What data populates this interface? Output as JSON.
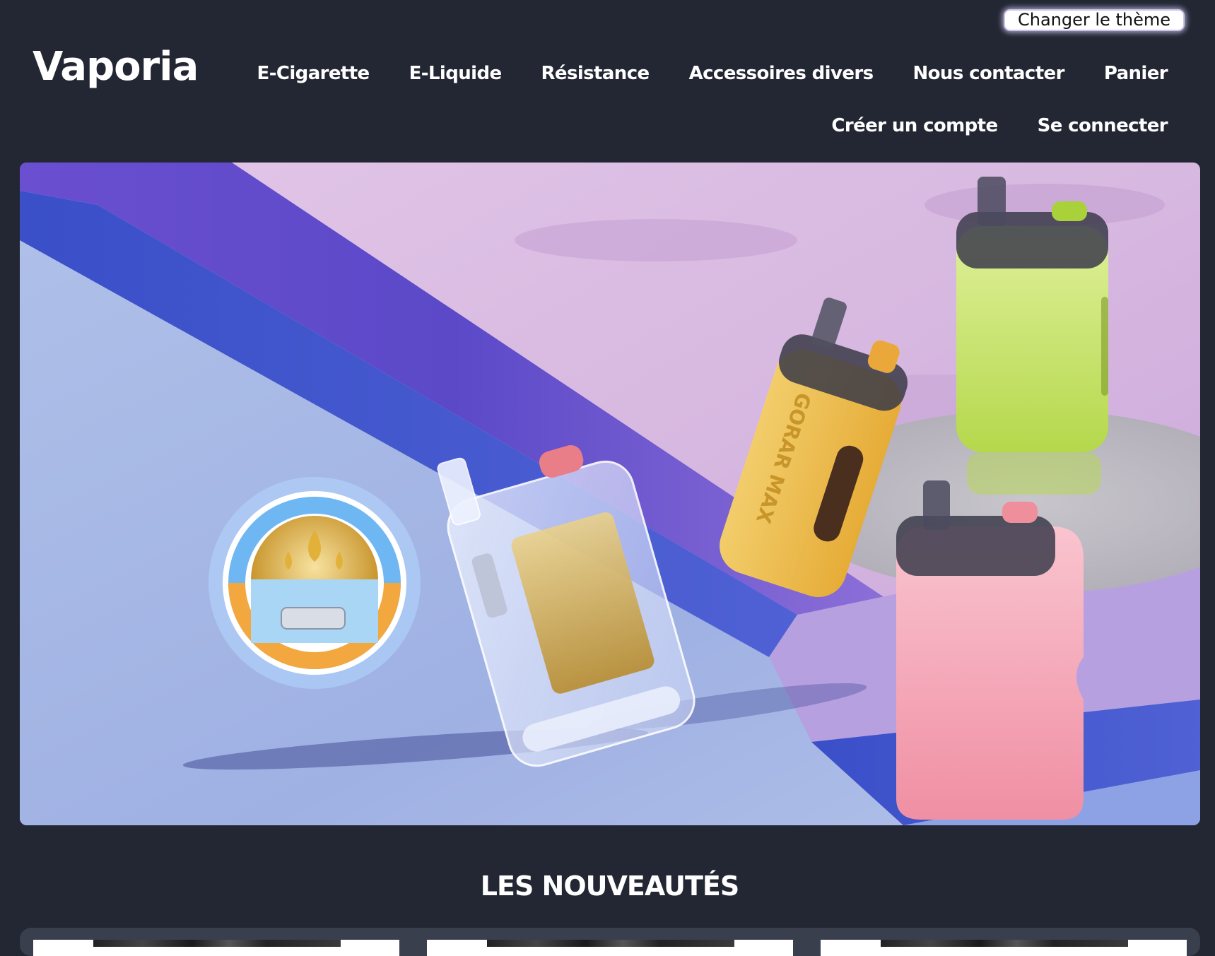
{
  "header": {
    "theme_button": "Changer le thème",
    "logo": "Vaporia",
    "nav_primary": [
      "E-Cigarette",
      "E-Liquide",
      "Résistance",
      "Accessoires divers",
      "Nous contacter",
      "Panier"
    ],
    "nav_secondary": [
      "Créer un compte",
      "Se connecter"
    ]
  },
  "hero": {
    "product_text": "GORAR MAX"
  },
  "new_products": {
    "title": "LES NOUVEAUTÉS",
    "count": 3
  },
  "colors": {
    "background": "#222733",
    "text": "#ffffff",
    "theme_button_bg": "#ffffff",
    "theme_button_glow": "#dcd2ff",
    "products_panel": "#3a3f4e"
  }
}
